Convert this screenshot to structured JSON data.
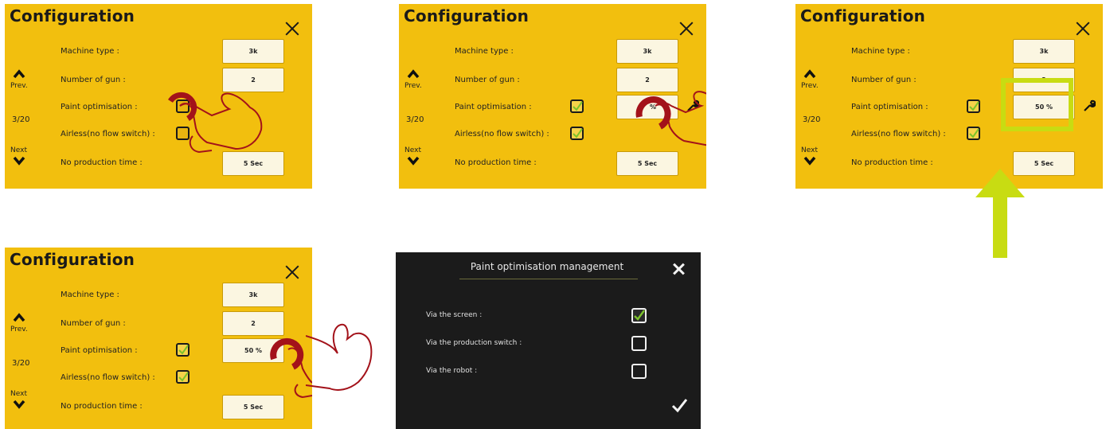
{
  "config": {
    "title": "Configuration",
    "nav": {
      "prev": "Prev.",
      "page": "3/20",
      "next": "Next"
    },
    "rows": [
      {
        "label": "Machine type :",
        "value": "3k"
      },
      {
        "label": "Number of gun :",
        "value": "2"
      },
      {
        "label": "Paint optimisation :",
        "value": "50 %"
      },
      {
        "label": "Airless(no flow switch) :"
      },
      {
        "label": "No production time :",
        "value": "5 Sec"
      }
    ],
    "partial_value": "5",
    "partial_value_tail": "%",
    "partial_gun": "2"
  },
  "dialog": {
    "title": "Paint optimisation management",
    "options": [
      {
        "label": "Via the screen :",
        "checked": true
      },
      {
        "label": "Via the production switch :",
        "checked": false
      },
      {
        "label": "Via the robot :",
        "checked": false
      }
    ]
  },
  "colors": {
    "panel_bg": "#f2bf0e",
    "check_green": "#7cc22b",
    "highlight_green": "#c8dc12",
    "hand_outline": "#a3121a"
  }
}
